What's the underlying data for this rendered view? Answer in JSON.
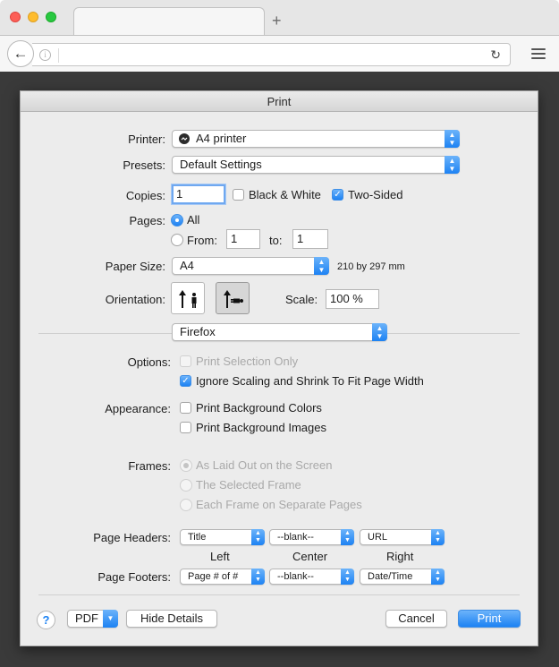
{
  "browser": {
    "new_tab_symbol": "+",
    "back_symbol": "←",
    "info_symbol": "i",
    "reload_symbol": "↻",
    "url": ""
  },
  "dialog": {
    "title": "Print",
    "printer": {
      "label": "Printer:",
      "value": "A4 printer"
    },
    "presets": {
      "label": "Presets:",
      "value": "Default Settings"
    },
    "copies": {
      "label": "Copies:",
      "value": "1"
    },
    "black_white": {
      "label": "Black & White",
      "checked": false
    },
    "two_sided": {
      "label": "Two-Sided",
      "checked": true
    },
    "pages": {
      "label": "Pages:",
      "all_label": "All",
      "from_label": "From:",
      "from_value": "1",
      "to_label": "to:",
      "to_value": "1"
    },
    "paper_size": {
      "label": "Paper Size:",
      "value": "A4",
      "dimensions": "210 by 297 mm"
    },
    "orientation": {
      "label": "Orientation:"
    },
    "scale": {
      "label": "Scale:",
      "value": "100 %"
    },
    "section_popup": "Firefox",
    "options": {
      "label": "Options:",
      "print_selection_only": "Print Selection Only",
      "ignore_scaling": "Ignore Scaling and Shrink To Fit Page Width"
    },
    "appearance": {
      "label": "Appearance:",
      "bg_colors": "Print Background Colors",
      "bg_images": "Print Background Images"
    },
    "frames": {
      "label": "Frames:",
      "as_laid_out": "As Laid Out on the Screen",
      "selected_frame": "The Selected Frame",
      "each_frame": "Each Frame on Separate Pages"
    },
    "headers_footers": {
      "headers_label": "Page Headers:",
      "footers_label": "Page Footers:",
      "left_label": "Left",
      "center_label": "Center",
      "right_label": "Right",
      "header_left": "Title",
      "header_center": "--blank--",
      "header_right": "URL",
      "footer_left": "Page # of #",
      "footer_center": "--blank--",
      "footer_right": "Date/Time"
    },
    "buttons": {
      "help": "?",
      "pdf": "PDF",
      "hide_details": "Hide Details",
      "cancel": "Cancel",
      "print": "Print"
    }
  },
  "colors": {
    "accent": "#1d82f3",
    "backdrop": "#3a3a3a",
    "sheet": "#ececec"
  }
}
